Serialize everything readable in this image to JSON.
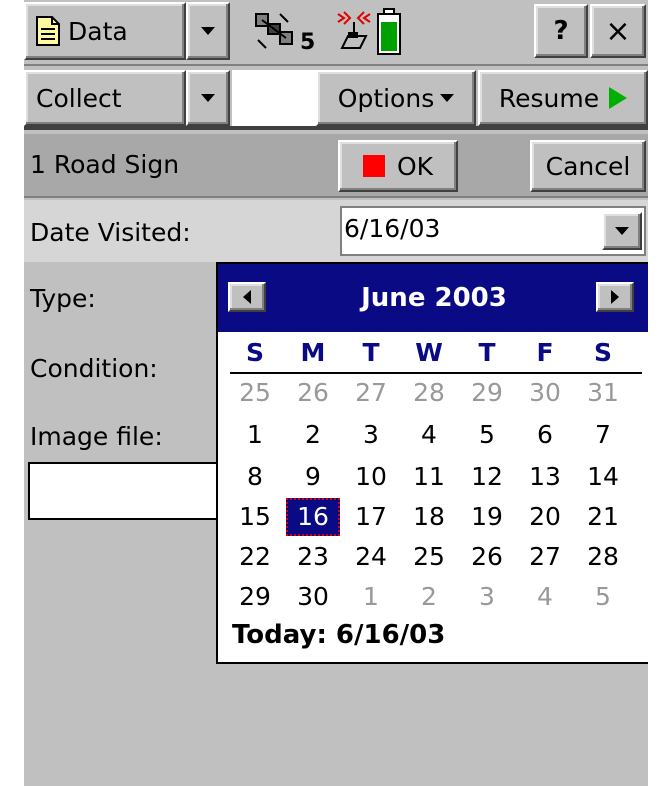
{
  "titlebar": {
    "app_label": "Data",
    "satellite_count": "5",
    "help_label": "?",
    "close_label": "×"
  },
  "toolbar": {
    "mode_label": "Collect",
    "options_label": "Options",
    "resume_label": "Resume"
  },
  "form": {
    "feature_name": "1 Road Sign",
    "ok_label": "OK",
    "cancel_label": "Cancel",
    "fields": {
      "date_visited_label": "Date Visited:",
      "date_visited_value": "6/16/03",
      "type_label": "Type:",
      "condition_label": "Condition:",
      "image_file_label": "Image file:",
      "image_file_value": ""
    }
  },
  "calendar": {
    "month_title": "June 2003",
    "weekdays": [
      "S",
      "M",
      "T",
      "W",
      "T",
      "F",
      "S"
    ],
    "weeks": [
      [
        {
          "d": "25",
          "o": true
        },
        {
          "d": "26",
          "o": true
        },
        {
          "d": "27",
          "o": true
        },
        {
          "d": "28",
          "o": true
        },
        {
          "d": "29",
          "o": true
        },
        {
          "d": "30",
          "o": true
        },
        {
          "d": "31",
          "o": true
        }
      ],
      [
        {
          "d": "1"
        },
        {
          "d": "2"
        },
        {
          "d": "3"
        },
        {
          "d": "4"
        },
        {
          "d": "5"
        },
        {
          "d": "6"
        },
        {
          "d": "7"
        }
      ],
      [
        {
          "d": "8"
        },
        {
          "d": "9"
        },
        {
          "d": "10"
        },
        {
          "d": "11"
        },
        {
          "d": "12"
        },
        {
          "d": "13"
        },
        {
          "d": "14"
        }
      ],
      [
        {
          "d": "15"
        },
        {
          "d": "16",
          "sel": true
        },
        {
          "d": "17"
        },
        {
          "d": "18"
        },
        {
          "d": "19"
        },
        {
          "d": "20"
        },
        {
          "d": "21"
        }
      ],
      [
        {
          "d": "22"
        },
        {
          "d": "23"
        },
        {
          "d": "24"
        },
        {
          "d": "25"
        },
        {
          "d": "26"
        },
        {
          "d": "27"
        },
        {
          "d": "28"
        }
      ],
      [
        {
          "d": "29"
        },
        {
          "d": "30"
        },
        {
          "d": "1",
          "o": true
        },
        {
          "d": "2",
          "o": true
        },
        {
          "d": "3",
          "o": true
        },
        {
          "d": "4",
          "o": true
        },
        {
          "d": "5",
          "o": true
        }
      ]
    ],
    "today_label": "Today: 6/16/03"
  },
  "colors": {
    "header_blue": "#0a0a84",
    "ok_square_red": "#ff0000",
    "resume_green": "#00b000",
    "battery_green": "#00a000"
  },
  "icons": [
    "document-icon",
    "satellite-icon",
    "antenna-icon",
    "battery-icon",
    "help-icon",
    "close-icon"
  ]
}
